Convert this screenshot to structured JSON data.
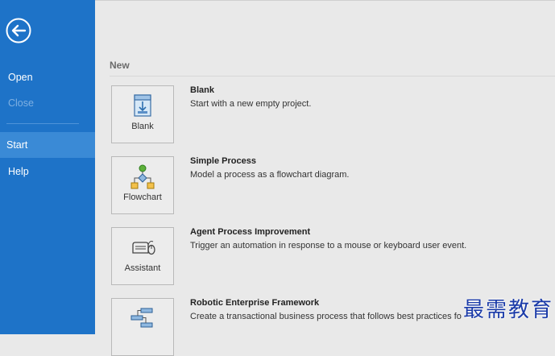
{
  "sidebar": {
    "back_icon": "back-arrow-icon",
    "items": [
      {
        "label": "Open",
        "state": "normal"
      },
      {
        "label": "Close",
        "state": "disabled"
      },
      {
        "label": "Start",
        "state": "active"
      },
      {
        "label": "Help",
        "state": "normal"
      }
    ],
    "colors": {
      "background": "#1e73c8",
      "active": "#3a8ad6",
      "disabled_text": "#7fb0e2"
    }
  },
  "main": {
    "section_title": "New",
    "templates": [
      {
        "tile_label": "Blank",
        "title": "Blank",
        "description": "Start with a new empty project.",
        "icon": "blank-project-icon"
      },
      {
        "tile_label": "Flowchart",
        "title": "Simple Process",
        "description": "Model a process as a flowchart diagram.",
        "icon": "flowchart-icon"
      },
      {
        "tile_label": "Assistant",
        "title": "Agent Process Improvement",
        "description": "Trigger an automation in response to a mouse or keyboard user event.",
        "icon": "keyboard-mouse-icon"
      },
      {
        "tile_label": "",
        "title": "Robotic Enterprise Framework",
        "description": "Create a transactional business process that follows best practices fo",
        "icon": "framework-icon"
      }
    ]
  },
  "watermark": "最需教育"
}
